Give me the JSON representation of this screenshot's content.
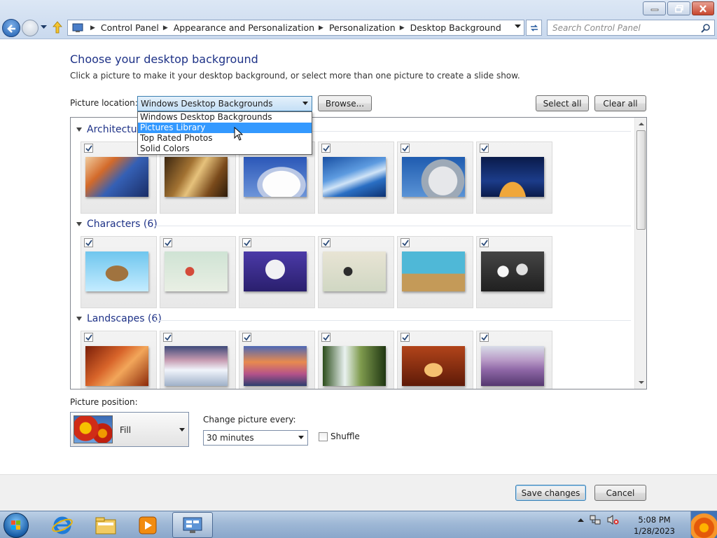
{
  "window": {
    "controls": {
      "minimize_icon": "minimize-icon",
      "maximize_icon": "restore-icon",
      "close_icon": "close-icon"
    }
  },
  "address": {
    "breadcrumbs": [
      "Control Panel",
      "Appearance and Personalization",
      "Personalization",
      "Desktop Background"
    ],
    "search_placeholder": "Search Control Panel"
  },
  "page": {
    "title": "Choose your desktop background",
    "subtitle": "Click a picture to make it your desktop background, or select more than one picture to create a slide show."
  },
  "picture_location": {
    "label": "Picture location:",
    "value": "Windows Desktop Backgrounds",
    "options": [
      "Windows Desktop Backgrounds",
      "Pictures Library",
      "Top Rated Photos",
      "Solid Colors"
    ],
    "highlighted": "Pictures Library",
    "browse_label": "Browse...",
    "select_all_label": "Select all",
    "clear_all_label": "Clear all"
  },
  "groups": [
    {
      "title": "Architecture",
      "thumbs": [
        "architecture-1",
        "architecture-2",
        "architecture-3",
        "architecture-4",
        "architecture-5",
        "architecture-6"
      ]
    },
    {
      "title": "Characters (6)",
      "thumbs": [
        "characters-1",
        "characters-2",
        "characters-3",
        "characters-4",
        "characters-5",
        "characters-6"
      ]
    },
    {
      "title": "Landscapes (6)",
      "thumbs": [
        "landscapes-1",
        "landscapes-2",
        "landscapes-3",
        "landscapes-4",
        "landscapes-5",
        "landscapes-6"
      ]
    }
  ],
  "position": {
    "label": "Picture position:",
    "value": "Fill"
  },
  "slideshow": {
    "label": "Change picture every:",
    "interval": "30 minutes",
    "shuffle_label": "Shuffle"
  },
  "footer": {
    "save_label": "Save changes",
    "cancel_label": "Cancel"
  },
  "taskbar": {
    "apps": [
      "internet-explorer-icon",
      "explorer-folder-icon",
      "media-player-icon",
      "control-panel-icon"
    ],
    "time": "5:08 PM",
    "date": "1/28/2023"
  }
}
